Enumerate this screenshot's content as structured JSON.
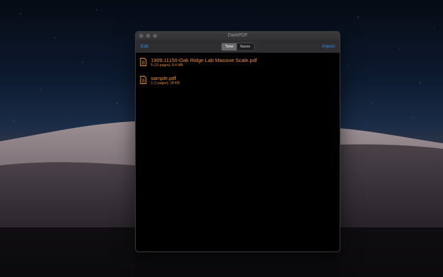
{
  "window": {
    "title": "DarkPDF"
  },
  "toolbar": {
    "edit_label": "Edit",
    "import_label": "Import",
    "sort": {
      "options": [
        "Time",
        "Name"
      ],
      "selected": "Time"
    }
  },
  "files": [
    {
      "name": "1909.11150-Oak Ridge Lab Massive Scale.pdf",
      "meta": "5 (13 pages), 8.4 MB"
    },
    {
      "name": "sample.pdf",
      "meta": "1 (1 pages), 18 KB"
    }
  ],
  "colors": {
    "accent": "#2f8cf0",
    "file_text": "#f0912e",
    "window_bg": "#000000"
  },
  "icons": [
    "document-icon"
  ]
}
